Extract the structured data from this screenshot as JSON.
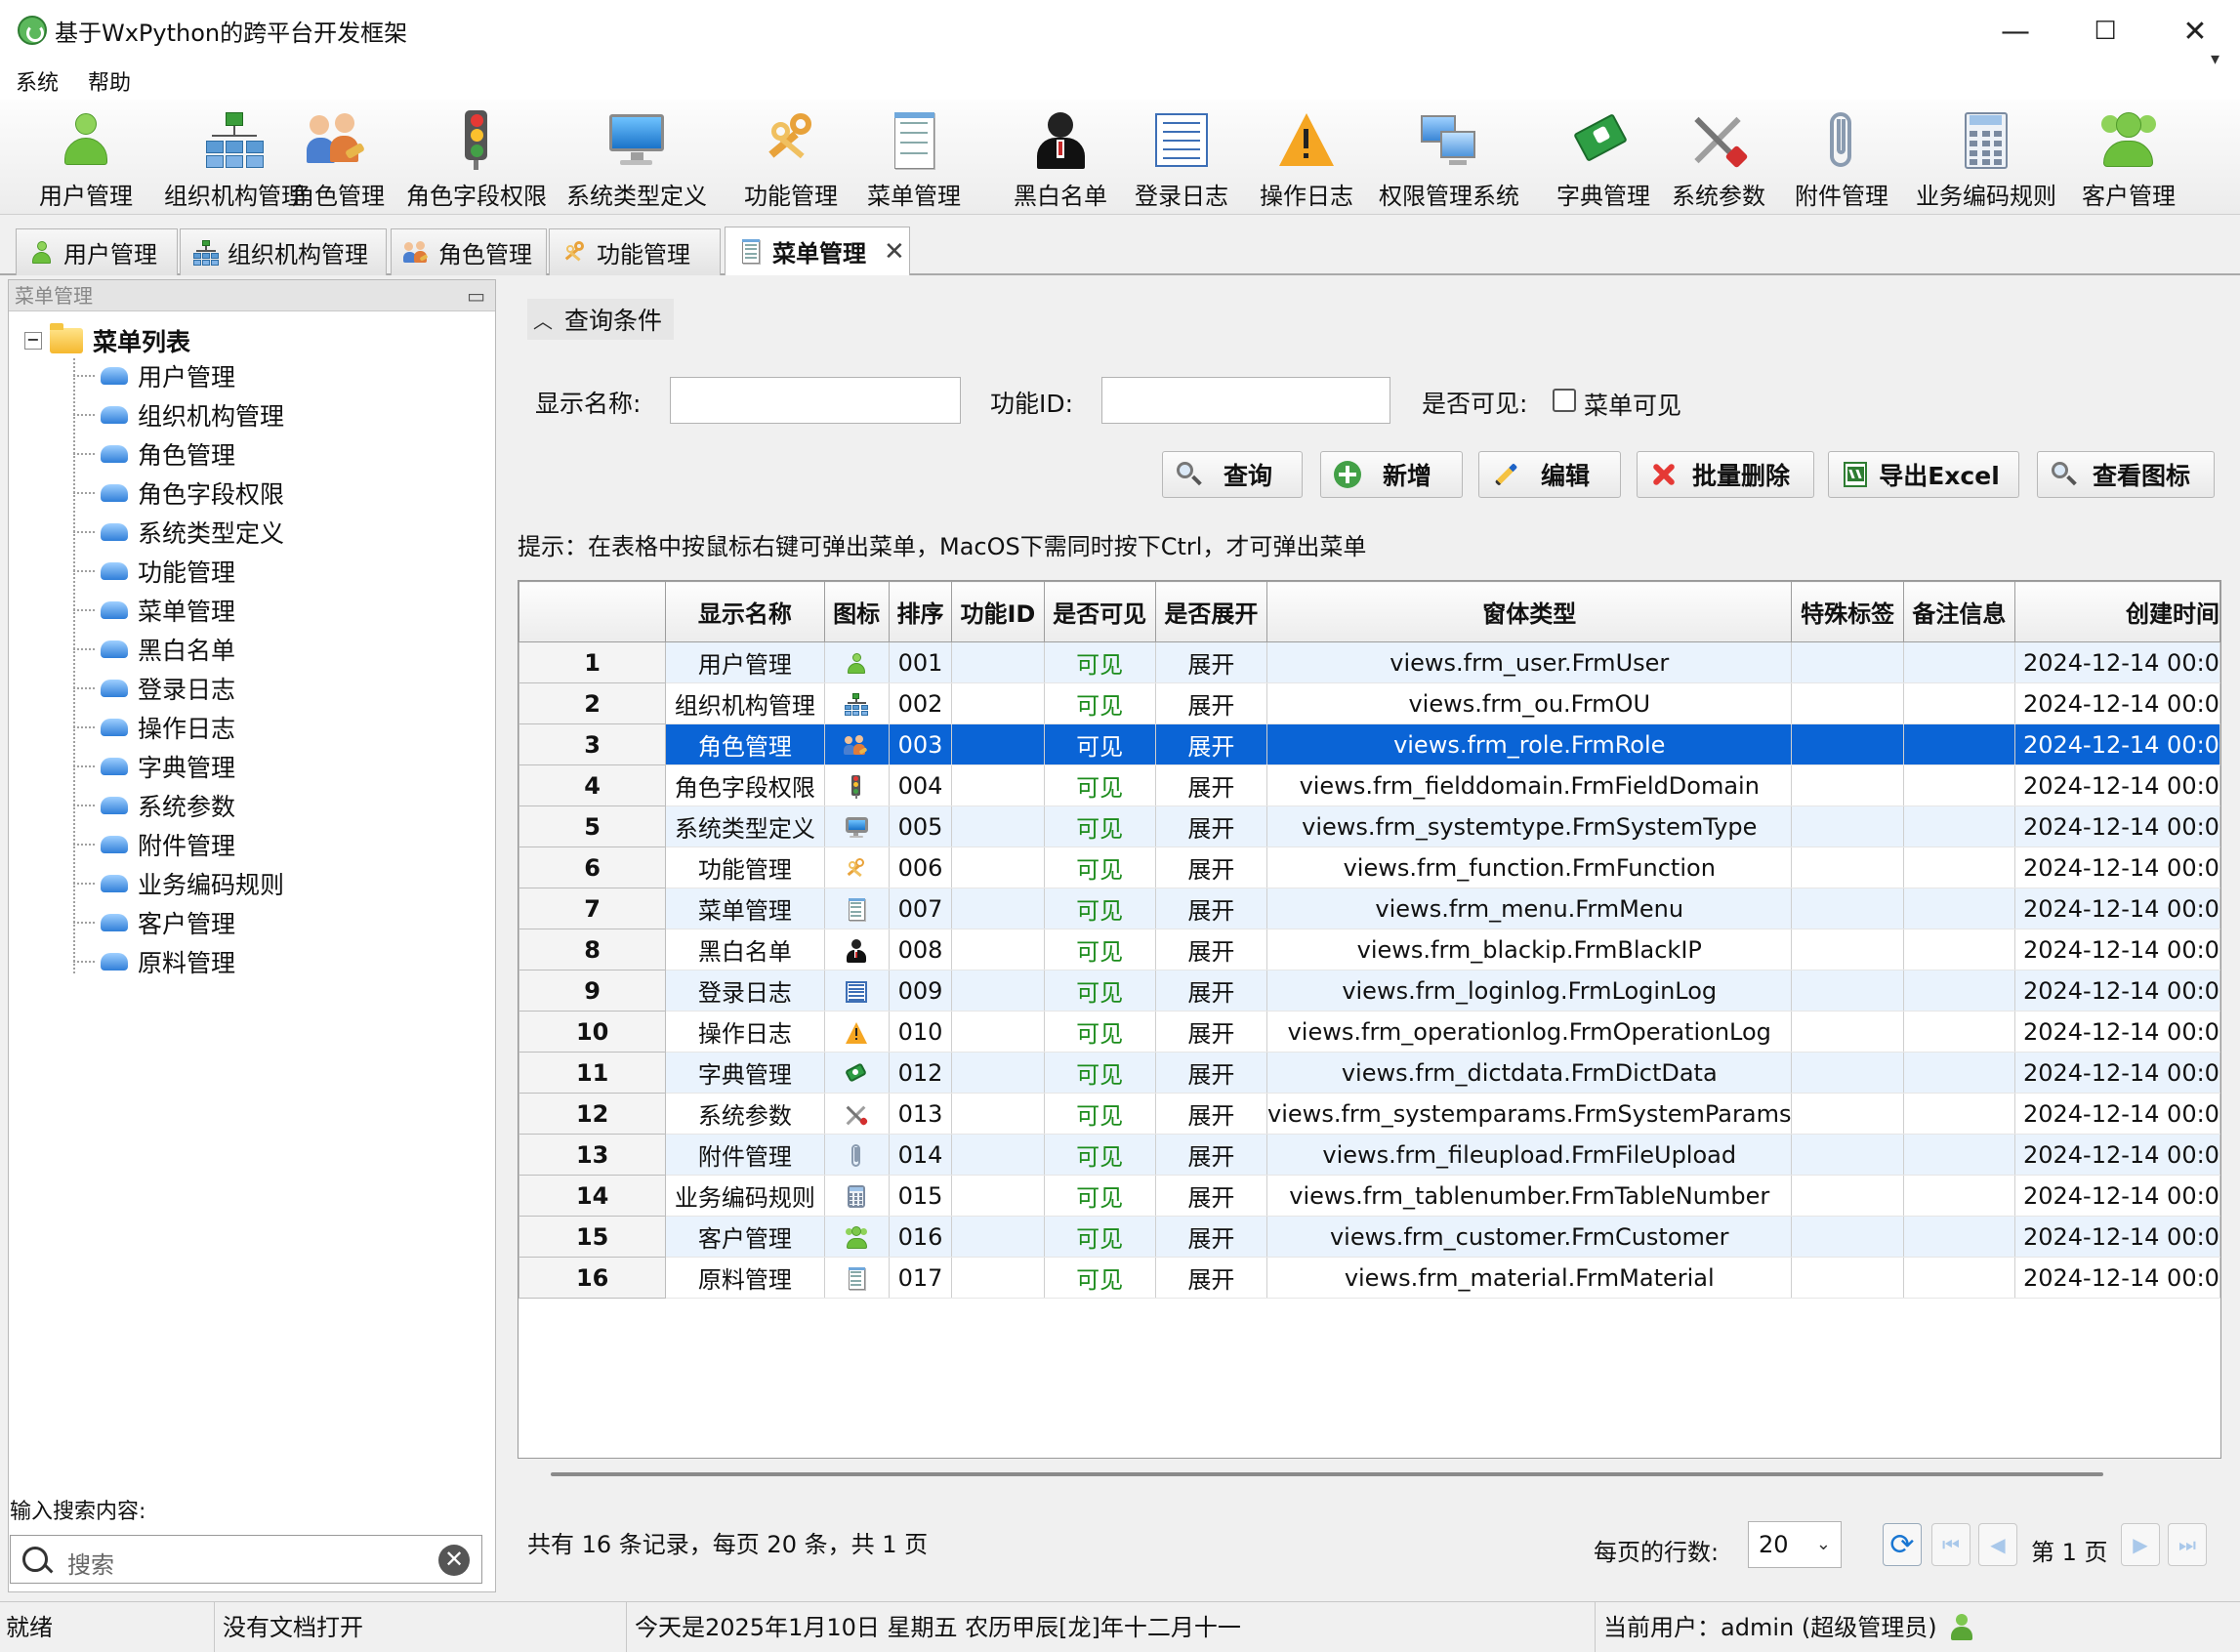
{
  "window": {
    "title": "基于WxPython的跨平台开发框架",
    "minimize": "—",
    "maximize": "☐",
    "close": "✕"
  },
  "menu": [
    "系统",
    "帮助"
  ],
  "toolbar": [
    {
      "label": "用户管理",
      "icon": "user-icon"
    },
    {
      "label": "组织机构管理",
      "icon": "org-chart-icon"
    },
    {
      "label": "角色管理",
      "icon": "role-icon"
    },
    {
      "label": "角色字段权限",
      "icon": "traffic-light-icon"
    },
    {
      "label": "系统类型定义",
      "icon": "monitor-icon"
    },
    {
      "label": "功能管理",
      "icon": "keys-icon"
    },
    {
      "label": "菜单管理",
      "icon": "menu-doc-icon"
    },
    {
      "label": "黑白名单",
      "icon": "agent-icon"
    },
    {
      "label": "登录日志",
      "icon": "log-list-icon"
    },
    {
      "label": "操作日志",
      "icon": "warning-icon"
    },
    {
      "label": "权限管理系统",
      "icon": "computers-icon"
    },
    {
      "label": "字典管理",
      "icon": "book-icon"
    },
    {
      "label": "系统参数",
      "icon": "tools-icon"
    },
    {
      "label": "附件管理",
      "icon": "paperclip-icon"
    },
    {
      "label": "业务编码规则",
      "icon": "calculator-icon"
    },
    {
      "label": "客户管理",
      "icon": "customers-icon"
    }
  ],
  "tabs": [
    {
      "label": "用户管理",
      "icon": "user-icon"
    },
    {
      "label": "组织机构管理",
      "icon": "org-chart-icon"
    },
    {
      "label": "角色管理",
      "icon": "role-icon"
    },
    {
      "label": "功能管理",
      "icon": "keys-icon"
    },
    {
      "label": "菜单管理",
      "icon": "menu-doc-icon",
      "active": true,
      "close": "✕"
    }
  ],
  "left_panel": {
    "caption": "菜单管理",
    "minimize": "▭",
    "tree_root": "菜单列表",
    "tree_expander": "−",
    "tree_items": [
      "用户管理",
      "组织机构管理",
      "角色管理",
      "角色字段权限",
      "系统类型定义",
      "功能管理",
      "菜单管理",
      "黑白名单",
      "登录日志",
      "操作日志",
      "字典管理",
      "系统参数",
      "附件管理",
      "业务编码规则",
      "客户管理",
      "原料管理"
    ],
    "search_label": "输入搜索内容:",
    "search_placeholder": "搜索",
    "search_clear": "✕"
  },
  "query": {
    "header": "查询条件",
    "chevron": "︿",
    "display_name_label": "显示名称:",
    "display_name_value": "",
    "function_id_label": "功能ID:",
    "function_id_value": "",
    "visible_label": "是否可见:",
    "visible_checkbox_label": "菜单可见",
    "visible_checked": false
  },
  "actions": [
    {
      "label": "查询",
      "icon": "search-icon"
    },
    {
      "label": "新增",
      "icon": "add-icon"
    },
    {
      "label": "编辑",
      "icon": "edit-icon"
    },
    {
      "label": "批量删除",
      "icon": "delete-icon"
    },
    {
      "label": "导出Excel",
      "icon": "excel-icon"
    },
    {
      "label": "查看图标",
      "icon": "search-icon"
    }
  ],
  "hint": "提示：在表格中按鼠标右键可弹出菜单，MacOS下需同时按下Ctrl，才可弹出菜单",
  "grid": {
    "columns": [
      "",
      "显示名称",
      "图标",
      "排序",
      "功能ID",
      "是否可见",
      "是否展开",
      "窗体类型",
      "特殊标签",
      "备注信息",
      "创建时间"
    ],
    "selected_row": 3,
    "rows": [
      {
        "no": "1",
        "name": "用户管理",
        "icon": "user-icon",
        "sort": "001",
        "fid": "",
        "visible": "可见",
        "expand": "展开",
        "form": "views.frm_user.FrmUser",
        "tag": "",
        "note": "",
        "created": "2024-12-14 00:0"
      },
      {
        "no": "2",
        "name": "组织机构管理",
        "icon": "org-chart-icon",
        "sort": "002",
        "fid": "",
        "visible": "可见",
        "expand": "展开",
        "form": "views.frm_ou.FrmOU",
        "tag": "",
        "note": "",
        "created": "2024-12-14 00:0"
      },
      {
        "no": "3",
        "name": "角色管理",
        "icon": "role-icon",
        "sort": "003",
        "fid": "",
        "visible": "可见",
        "expand": "展开",
        "form": "views.frm_role.FrmRole",
        "tag": "",
        "note": "",
        "created": "2024-12-14 00:0"
      },
      {
        "no": "4",
        "name": "角色字段权限",
        "icon": "traffic-light-icon",
        "sort": "004",
        "fid": "",
        "visible": "可见",
        "expand": "展开",
        "form": "views.frm_fielddomain.FrmFieldDomain",
        "tag": "",
        "note": "",
        "created": "2024-12-14 00:0"
      },
      {
        "no": "5",
        "name": "系统类型定义",
        "icon": "monitor-icon",
        "sort": "005",
        "fid": "",
        "visible": "可见",
        "expand": "展开",
        "form": "views.frm_systemtype.FrmSystemType",
        "tag": "",
        "note": "",
        "created": "2024-12-14 00:0"
      },
      {
        "no": "6",
        "name": "功能管理",
        "icon": "keys-icon",
        "sort": "006",
        "fid": "",
        "visible": "可见",
        "expand": "展开",
        "form": "views.frm_function.FrmFunction",
        "tag": "",
        "note": "",
        "created": "2024-12-14 00:0"
      },
      {
        "no": "7",
        "name": "菜单管理",
        "icon": "menu-doc-icon",
        "sort": "007",
        "fid": "",
        "visible": "可见",
        "expand": "展开",
        "form": "views.frm_menu.FrmMenu",
        "tag": "",
        "note": "",
        "created": "2024-12-14 00:0"
      },
      {
        "no": "8",
        "name": "黑白名单",
        "icon": "agent-icon",
        "sort": "008",
        "fid": "",
        "visible": "可见",
        "expand": "展开",
        "form": "views.frm_blackip.FrmBlackIP",
        "tag": "",
        "note": "",
        "created": "2024-12-14 00:0"
      },
      {
        "no": "9",
        "name": "登录日志",
        "icon": "log-list-icon",
        "sort": "009",
        "fid": "",
        "visible": "可见",
        "expand": "展开",
        "form": "views.frm_loginlog.FrmLoginLog",
        "tag": "",
        "note": "",
        "created": "2024-12-14 00:0"
      },
      {
        "no": "10",
        "name": "操作日志",
        "icon": "warning-icon",
        "sort": "010",
        "fid": "",
        "visible": "可见",
        "expand": "展开",
        "form": "views.frm_operationlog.FrmOperationLog",
        "tag": "",
        "note": "",
        "created": "2024-12-14 00:0"
      },
      {
        "no": "11",
        "name": "字典管理",
        "icon": "book-icon",
        "sort": "012",
        "fid": "",
        "visible": "可见",
        "expand": "展开",
        "form": "views.frm_dictdata.FrmDictData",
        "tag": "",
        "note": "",
        "created": "2024-12-14 00:0"
      },
      {
        "no": "12",
        "name": "系统参数",
        "icon": "tools-icon",
        "sort": "013",
        "fid": "",
        "visible": "可见",
        "expand": "展开",
        "form": "views.frm_systemparams.FrmSystemParams",
        "tag": "",
        "note": "",
        "created": "2024-12-14 00:0"
      },
      {
        "no": "13",
        "name": "附件管理",
        "icon": "paperclip-icon",
        "sort": "014",
        "fid": "",
        "visible": "可见",
        "expand": "展开",
        "form": "views.frm_fileupload.FrmFileUpload",
        "tag": "",
        "note": "",
        "created": "2024-12-14 00:0"
      },
      {
        "no": "14",
        "name": "业务编码规则",
        "icon": "calculator-icon",
        "sort": "015",
        "fid": "",
        "visible": "可见",
        "expand": "展开",
        "form": "views.frm_tablenumber.FrmTableNumber",
        "tag": "",
        "note": "",
        "created": "2024-12-14 00:0"
      },
      {
        "no": "15",
        "name": "客户管理",
        "icon": "customers-icon",
        "sort": "016",
        "fid": "",
        "visible": "可见",
        "expand": "展开",
        "form": "views.frm_customer.FrmCustomer",
        "tag": "",
        "note": "",
        "created": "2024-12-14 00:0"
      },
      {
        "no": "16",
        "name": "原料管理",
        "icon": "list-doc-icon",
        "sort": "017",
        "fid": "",
        "visible": "可见",
        "expand": "展开",
        "form": "views.frm_material.FrmMaterial",
        "tag": "",
        "note": "",
        "created": "2024-12-14 00:0"
      }
    ]
  },
  "pager": {
    "summary": "共有 16 条记录，每页 20 条，共 1 页",
    "rows_per_page_label": "每页的行数:",
    "rows_per_page": "20",
    "dropdown": "⌄",
    "refresh": "⟳",
    "first": "⏮",
    "prev": "◀",
    "current": "第 1 页",
    "next": "▶",
    "last": "⏭"
  },
  "status": {
    "ready": "就绪",
    "doc": "没有文档打开",
    "date": "今天是2025年1月10日 星期五 农历甲辰[龙]年十二月十一",
    "user": "当前用户：admin (超级管理员)"
  },
  "colors": {
    "selection": "#0a64d6",
    "visible_text": "#1c8c1c",
    "row_alt": "#eaf3fd"
  }
}
